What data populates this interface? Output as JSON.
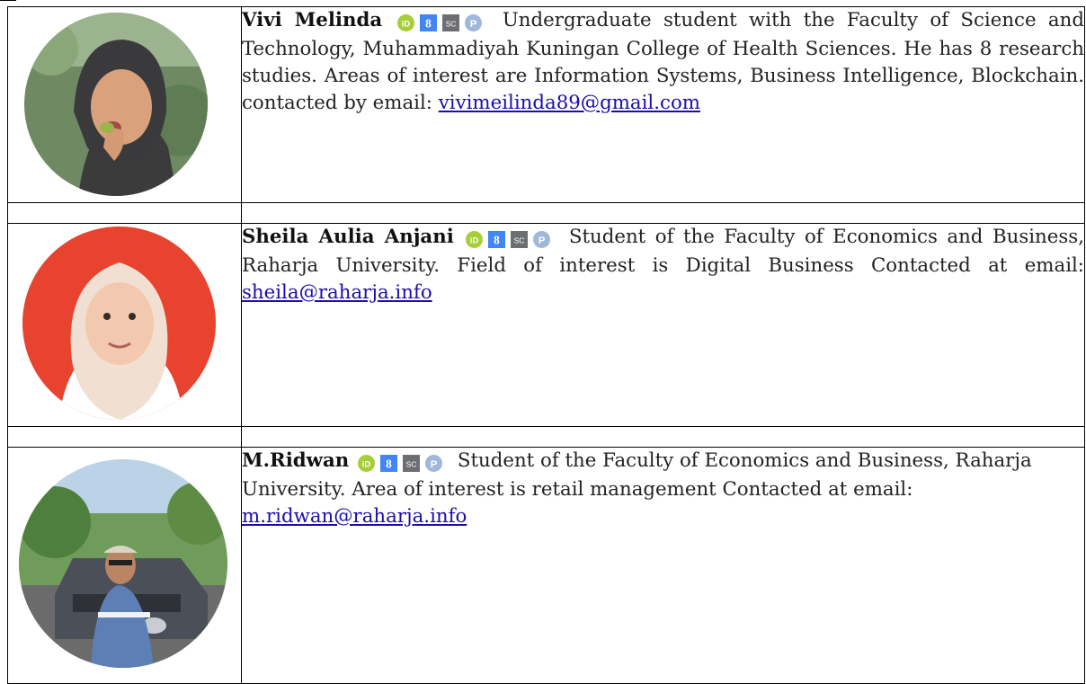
{
  "people": [
    {
      "name": "Vivi Melinda",
      "bio": "Undergraduate student with the Faculty of Science and Technology, Muhammadiyah Kuningan College of Health Sciences. He has 8 research studies.  Areas of interest are Information Systems, Business Intelligence, Blockchain. contacted by email:",
      "email": "vivimeilinda89@gmail.com",
      "icons": [
        "orcid-icon",
        "google-scholar-icon",
        "scopus-icon",
        "publons-icon"
      ]
    },
    {
      "name": "Sheila Aulia Anjani",
      "bio": "Student of the Faculty of Economics and Business, Raharja University. Field of interest is Digital Business Contacted at email:",
      "email": "sheila@raharja.info",
      "icons": [
        "orcid-icon",
        "google-scholar-icon",
        "scopus-icon",
        "publons-icon"
      ]
    },
    {
      "name": "M.Ridwan",
      "bio": "Student of the Faculty of Economics and Business, Raharja University. Area of interest is retail management Contacted at email:",
      "email": "m.ridwan@raharja.info",
      "icons": [
        "orcid-icon",
        "google-scholar-icon",
        "scopus-icon",
        "publons-icon"
      ]
    }
  ],
  "icon_labels": {
    "scopus": "SC",
    "publons": "P",
    "orcid": "iD"
  },
  "colors": {
    "orcid": "#a6ce39",
    "scholar": "#4285f4",
    "scopus": "#6d6e71",
    "publons": "#9fb7d9",
    "link": "#1a0dab"
  }
}
